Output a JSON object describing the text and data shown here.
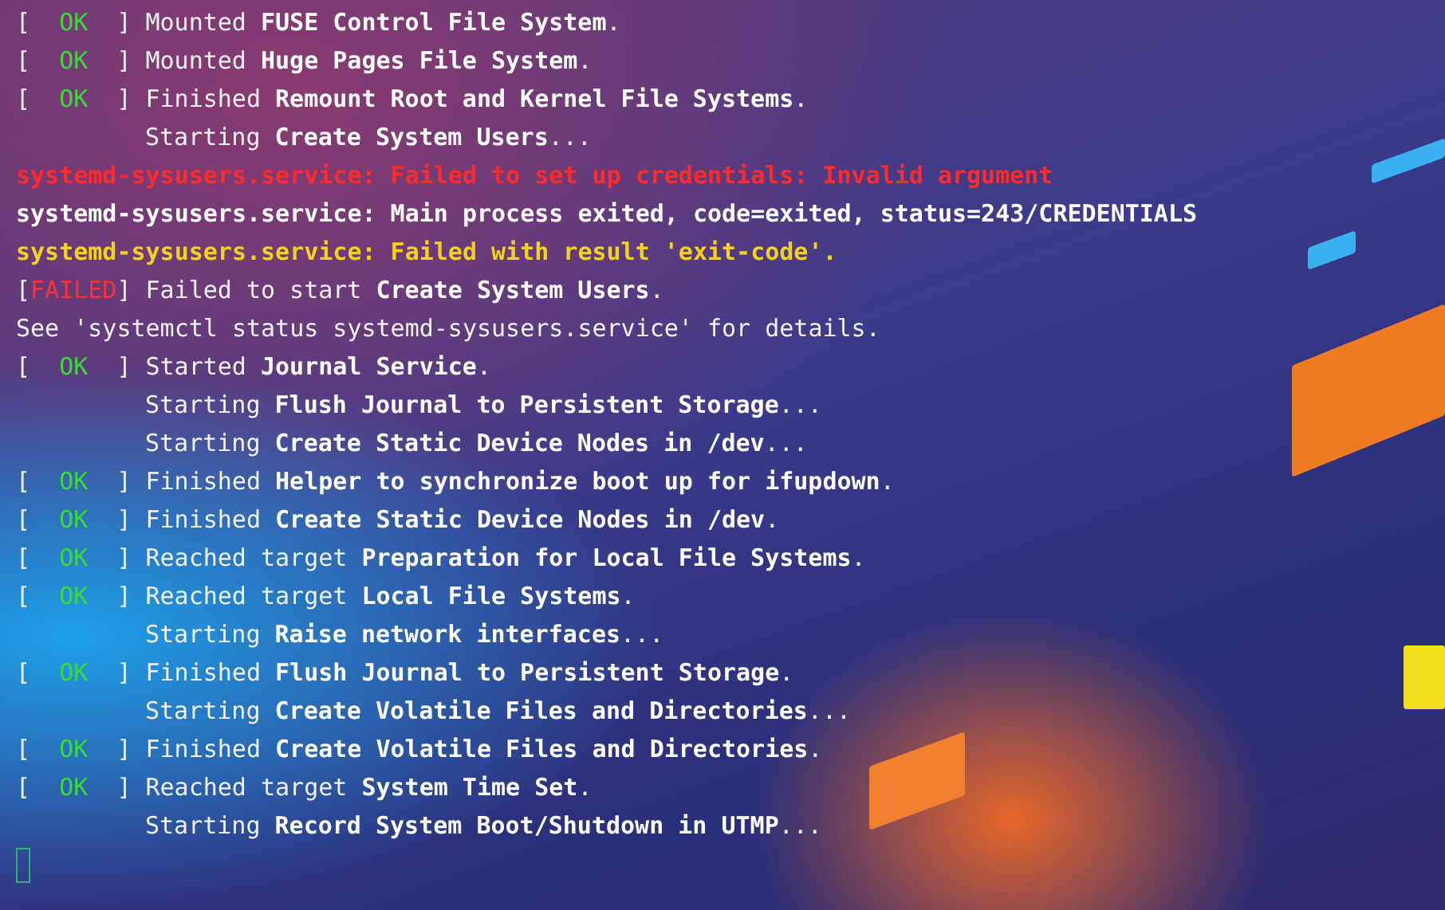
{
  "lines": [
    {
      "kind": "status",
      "open": "[",
      "status": "OK",
      "close": "]",
      "text": "Mounted **FUSE Control File System**."
    },
    {
      "kind": "status",
      "open": "[",
      "status": "OK",
      "close": "]",
      "text": "Mounted **Huge Pages File System**."
    },
    {
      "kind": "status",
      "open": "[",
      "status": "OK",
      "close": "]",
      "text": "Finished **Remount Root and Kernel File Systems**."
    },
    {
      "kind": "job",
      "text": "Starting **Create System Users**..."
    },
    {
      "kind": "message",
      "color": "#ff2a2a",
      "text": "systemd-sysusers.service: Failed to set up credentials: Invalid argument"
    },
    {
      "kind": "message",
      "color": "#ffffff",
      "text": "systemd-sysusers.service: Main process exited, code=exited, status=243/CREDENTIALS"
    },
    {
      "kind": "message",
      "color": "#f2d21a",
      "text": "systemd-sysusers.service: Failed with result 'exit-code'."
    },
    {
      "kind": "status",
      "open": "[",
      "status": "FAILED",
      "close": "]",
      "text": "Failed to start **Create System Users**."
    },
    {
      "kind": "note",
      "text": "See 'systemctl status systemd-sysusers.service' for details."
    },
    {
      "kind": "status",
      "open": "[",
      "status": "OK",
      "close": "]",
      "text": "Started **Journal Service**."
    },
    {
      "kind": "job",
      "text": "Starting **Flush Journal to Persistent Storage**..."
    },
    {
      "kind": "job",
      "text": "Starting **Create Static Device Nodes in /dev**..."
    },
    {
      "kind": "status",
      "open": "[",
      "status": "OK",
      "close": "]",
      "text": "Finished **Helper to synchronize boot up for ifupdown**."
    },
    {
      "kind": "status",
      "open": "[",
      "status": "OK",
      "close": "]",
      "text": "Finished **Create Static Device Nodes in /dev**."
    },
    {
      "kind": "status",
      "open": "[",
      "status": "OK",
      "close": "]",
      "text": "Reached target **Preparation for Local File Systems**."
    },
    {
      "kind": "status",
      "open": "[",
      "status": "OK",
      "close": "]",
      "text": "Reached target **Local File Systems**."
    },
    {
      "kind": "job",
      "text": "Starting **Raise network interfaces**..."
    },
    {
      "kind": "status",
      "open": "[",
      "status": "OK",
      "close": "]",
      "text": "Finished **Flush Journal to Persistent Storage**."
    },
    {
      "kind": "job",
      "text": "Starting **Create Volatile Files and Directories**..."
    },
    {
      "kind": "status",
      "open": "[",
      "status": "OK",
      "close": "]",
      "text": "Finished **Create Volatile Files and Directories**."
    },
    {
      "kind": "status",
      "open": "[",
      "status": "OK",
      "close": "]",
      "text": "Reached target **System Time Set**."
    },
    {
      "kind": "job",
      "text": "Starting **Record System Boot/Shutdown in UTMP**..."
    }
  ]
}
